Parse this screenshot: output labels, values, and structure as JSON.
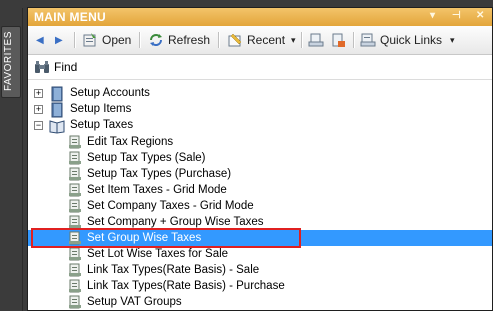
{
  "window": {
    "title": "MAIN MENU",
    "pin_glyph": "▾",
    "dock_glyph": "⊣",
    "close_glyph": "✕"
  },
  "favorites": {
    "label": "FAVORITES"
  },
  "toolbar": {
    "back_glyph": "◀",
    "forward_glyph": "▶",
    "open_label": "Open",
    "refresh_label": "Refresh",
    "recent_label": "Recent",
    "recent_arrow": "▾",
    "quick_links_label": "Quick Links",
    "quick_links_arrow": "▾"
  },
  "find": {
    "label": "Find"
  },
  "tree": {
    "groups": [
      {
        "label": "Setup Accounts",
        "expander": "+"
      },
      {
        "label": "Setup Items",
        "expander": "+"
      },
      {
        "label": "Setup Taxes",
        "expander": "−"
      }
    ],
    "children": [
      {
        "label": "Edit Tax Regions"
      },
      {
        "label": "Setup Tax Types (Sale)"
      },
      {
        "label": "Setup Tax Types (Purchase)"
      },
      {
        "label": "Set Item Taxes - Grid Mode"
      },
      {
        "label": "Set Company Taxes - Grid Mode"
      },
      {
        "label": "Set Company + Group Wise Taxes"
      },
      {
        "label": "Set Group Wise Taxes",
        "selected": true
      },
      {
        "label": "Set Lot Wise Taxes for Sale"
      },
      {
        "label": "Link Tax Types(Rate Basis) - Sale"
      },
      {
        "label": "Link Tax Types(Rate Basis) - Purchase"
      },
      {
        "label": "Setup VAT Groups"
      }
    ]
  },
  "colors": {
    "title_bar": "#e9ae45",
    "selection": "#3399ff",
    "highlight_box": "#e02020"
  }
}
